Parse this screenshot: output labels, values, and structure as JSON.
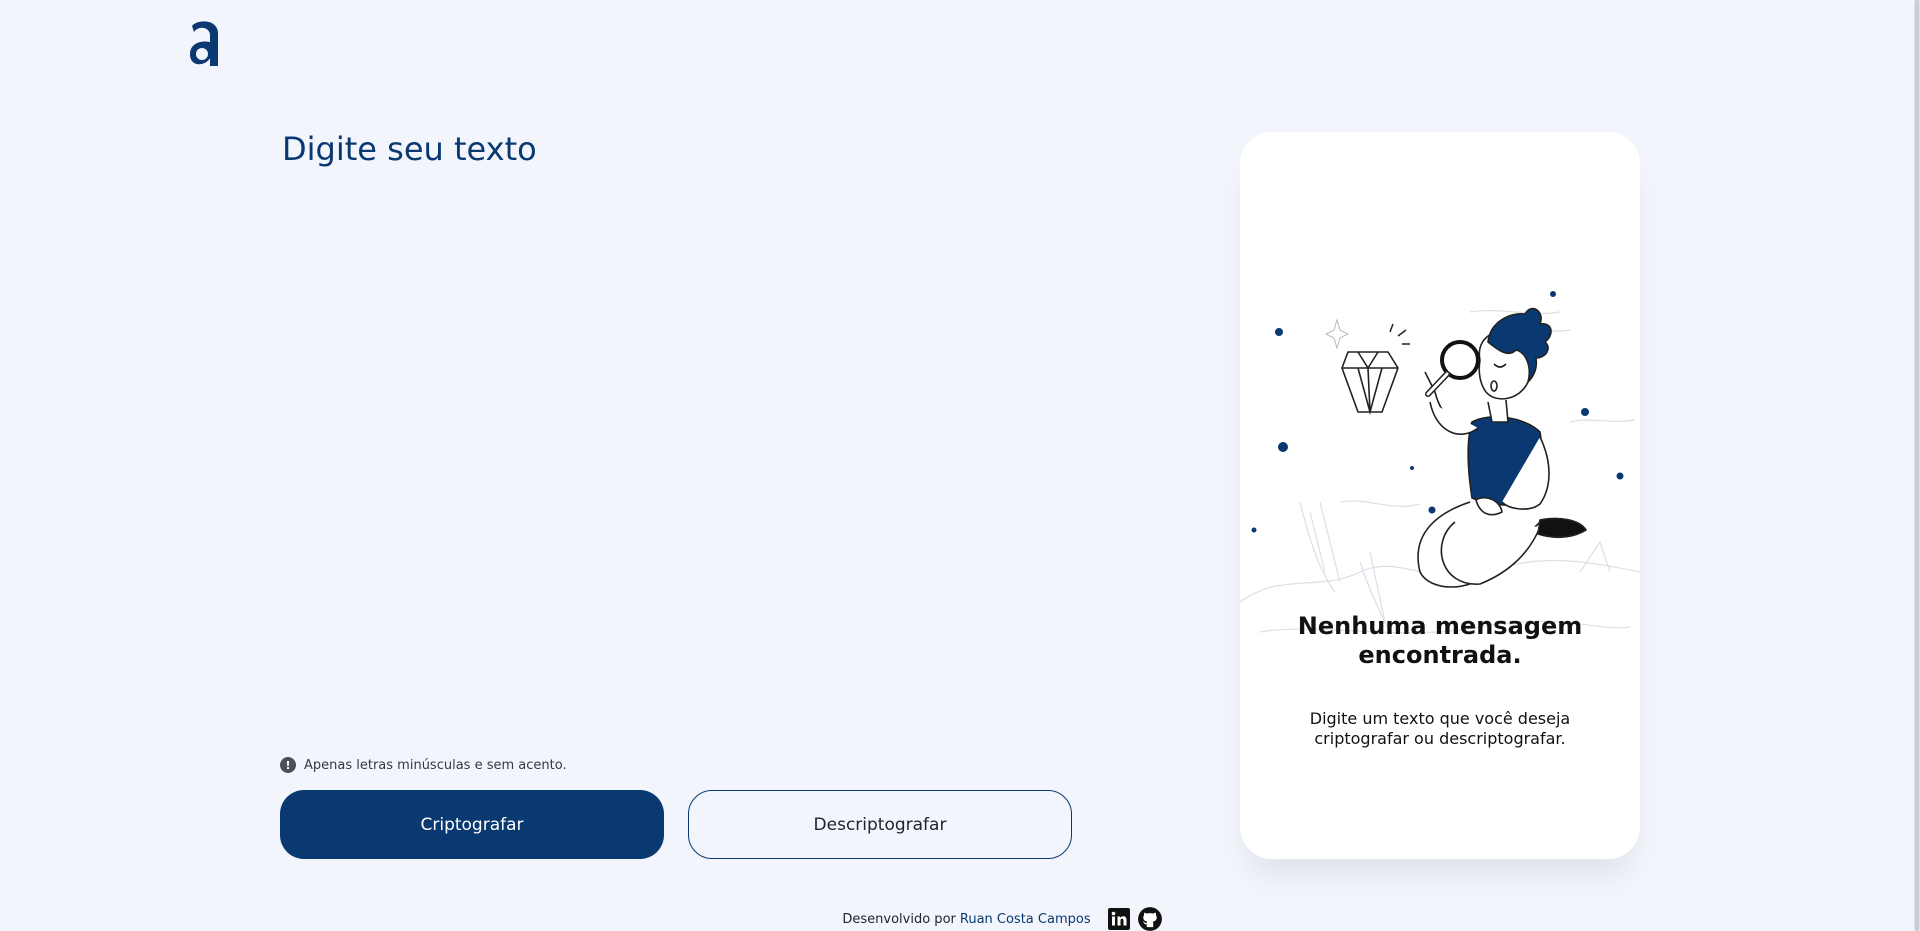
{
  "colors": {
    "brand": "#0a3871",
    "background": "#f3f5fc",
    "card": "#ffffff"
  },
  "logo": {
    "icon": "alura-a-logo-icon"
  },
  "input": {
    "placeholder": "Digite seu texto",
    "value": ""
  },
  "hint": {
    "icon": "exclamation-circle-icon",
    "text": "Apenas letras minúsculas e sem acento."
  },
  "buttons": {
    "encrypt": "Criptografar",
    "decrypt": "Descriptografar"
  },
  "output": {
    "illustration": "person-with-magnifying-glass-illustration",
    "title": "Nenhuma mensagem encontrada.",
    "text": "Digite um texto que você deseja criptografar ou descriptografar."
  },
  "footer": {
    "prefix": "Desenvolvido por",
    "author": "Ruan Costa Campos",
    "linkedin_icon": "linkedin-icon",
    "github_icon": "github-icon"
  }
}
